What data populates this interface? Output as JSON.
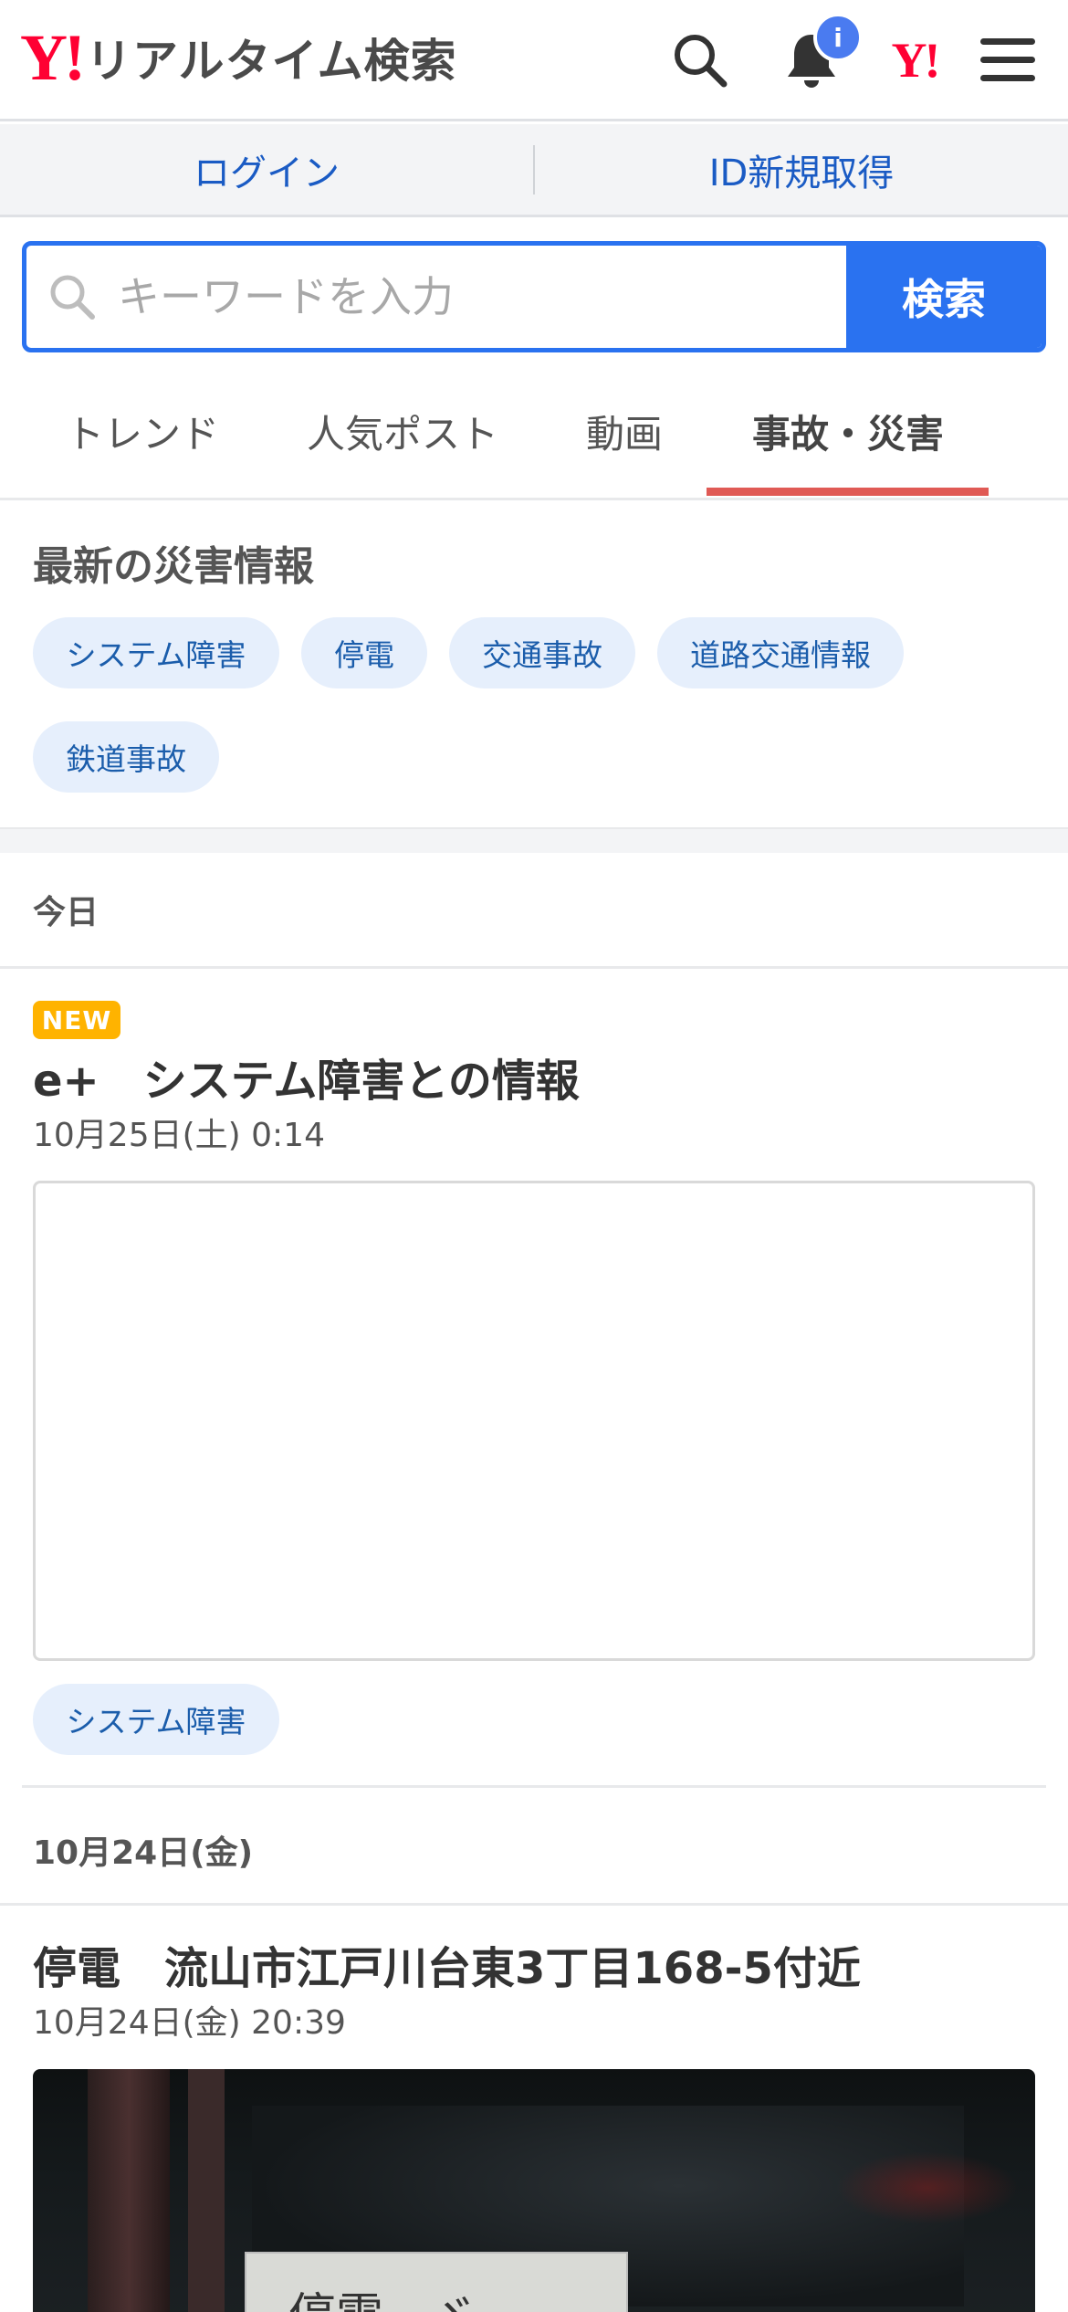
{
  "header": {
    "logo_mark": "Y!",
    "logo_text": "リアルタイム検索",
    "notification_badge": "i",
    "yahoo_mark": "Y!"
  },
  "auth": {
    "login": "ログイン",
    "signup": "ID新規取得"
  },
  "search": {
    "placeholder": "キーワードを入力",
    "button": "検索"
  },
  "tabs": [
    {
      "label": "トレンド",
      "active": false
    },
    {
      "label": "人気ポスト",
      "active": false
    },
    {
      "label": "動画",
      "active": false
    },
    {
      "label": "事故・災害",
      "active": true
    }
  ],
  "disaster": {
    "title": "最新の災害情報",
    "chips": [
      "システム障害",
      "停電",
      "交通事故",
      "道路交通情報",
      "鉄道事故"
    ]
  },
  "feed": {
    "today_label": "今日",
    "post1": {
      "badge": "NEW",
      "title": "e+　システム障害との情報",
      "time": "10月25日(土) 0:14",
      "tag": "システム障害"
    },
    "day2_label": "10月24日(金)",
    "post2": {
      "title": "停電　流山市江戸川台東3丁目168-5付近",
      "time": "10月24日(金) 20:39",
      "photo_text": "停電　ゞ"
    }
  },
  "colors": {
    "brand_red": "#ff0033",
    "accent_blue": "#2a72f0",
    "link_blue": "#1a5bc4",
    "tab_underline": "#e05a55",
    "chip_bg": "#e6effc",
    "new_badge": "#ffb300",
    "badge_blue": "#4a7bf0"
  },
  "icons": [
    "search-icon",
    "bell-icon",
    "menu-icon",
    "search-input-icon"
  ]
}
